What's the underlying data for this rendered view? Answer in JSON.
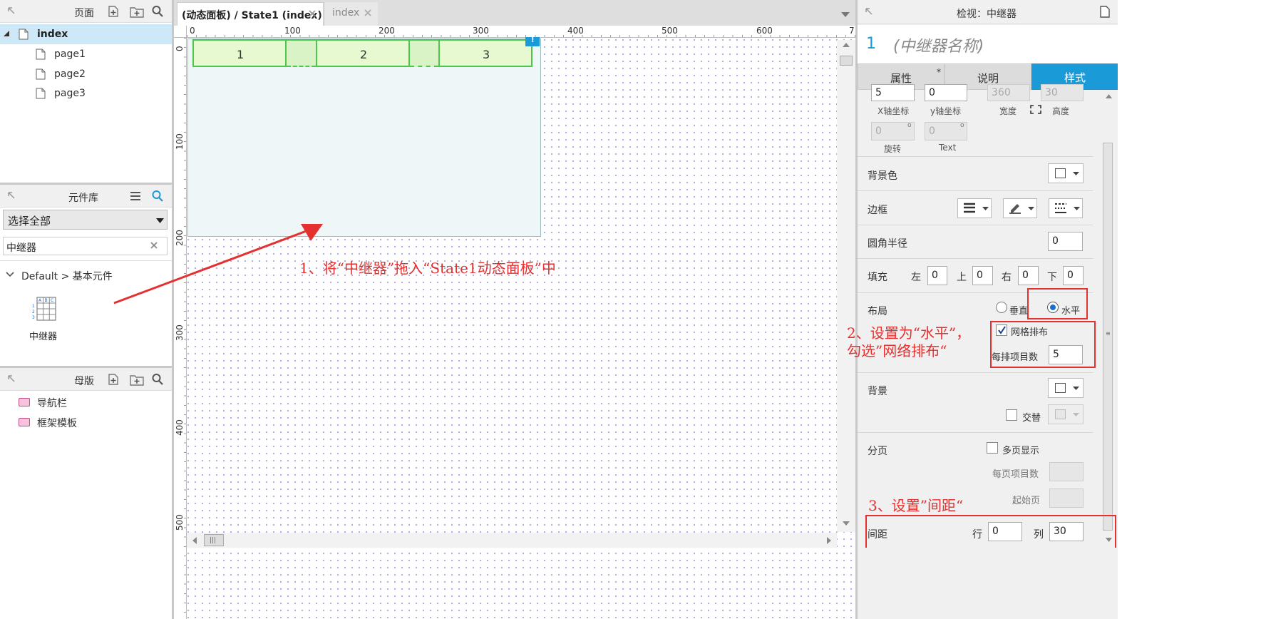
{
  "pages_pane": {
    "title": "页面",
    "items": [
      {
        "label": "index"
      },
      {
        "label": "page1"
      },
      {
        "label": "page2"
      },
      {
        "label": "page3"
      }
    ]
  },
  "library_pane": {
    "title": "元件库",
    "select_value": "选择全部",
    "search_value": "中继器",
    "group_label": "Default > 基本元件",
    "widget_label": "中继器"
  },
  "masters_pane": {
    "title": "母版",
    "items": [
      {
        "label": "导航栏"
      },
      {
        "label": "框架模板"
      }
    ]
  },
  "tabs": [
    {
      "label": "(动态面板) / State1 (index)"
    },
    {
      "label": "index"
    }
  ],
  "ruler": {
    "x": [
      "0",
      "100",
      "200",
      "300",
      "400",
      "500",
      "600",
      "7"
    ],
    "y": [
      "0",
      "100",
      "200",
      "300",
      "400",
      "500"
    ]
  },
  "repeater_items": [
    "1",
    "2",
    "3"
  ],
  "annotations": {
    "step1": "1、将“中继器”拖入“State1动态面板”中",
    "step2_line1": "2、设置为“水平”，",
    "step2_line2": "勾选”网络排布“",
    "step3": "3、设置”间距“"
  },
  "inspector": {
    "header": "检视：中继器",
    "number": "1",
    "name_placeholder": "(中继器名称)",
    "tabs": [
      "属性",
      "说明",
      "样式"
    ],
    "tab_star": "*",
    "x_value": "5",
    "y_value": "0",
    "width_value": "360",
    "height_value": "30",
    "x_label": "X轴坐标",
    "y_label": "y轴坐标",
    "width_label": "宽度",
    "height_label": "高度",
    "rotate_value": "0",
    "text_rotate_value": "0",
    "deg": "o",
    "rotate_label": "旋转",
    "text_label": "Text",
    "bg_color_label": "背景色",
    "border_label": "边框",
    "radius_label": "圆角半径",
    "radius_value": "0",
    "padding_label": "填充",
    "padding": {
      "left_label": "左",
      "left": "0",
      "top_label": "上",
      "top": "0",
      "right_label": "右",
      "right": "0",
      "bottom_label": "下",
      "bottom": "0"
    },
    "layout_label": "布局",
    "vertical_label": "垂直",
    "horizontal_label": "水平",
    "grid_label": "网格排布",
    "per_row_label": "每排项目数",
    "per_row_value": "5",
    "background_label": "背景",
    "alternate_label": "交替",
    "paging_label": "分页",
    "multipage_label": "多页显示",
    "per_page_label": "每页项目数",
    "start_page_label": "起始页",
    "spacing_label": "间距",
    "row_label": "行",
    "row_value": "0",
    "col_label": "列",
    "col_value": "30"
  },
  "colors": {
    "accent": "#1a9ad6",
    "selected_row": "#cde8f7",
    "repeater_fill": "#e6f9d0",
    "repeater_border": "#4cc74c",
    "panel_fill": "#eef6f8",
    "annotation_red": "#e53030"
  }
}
